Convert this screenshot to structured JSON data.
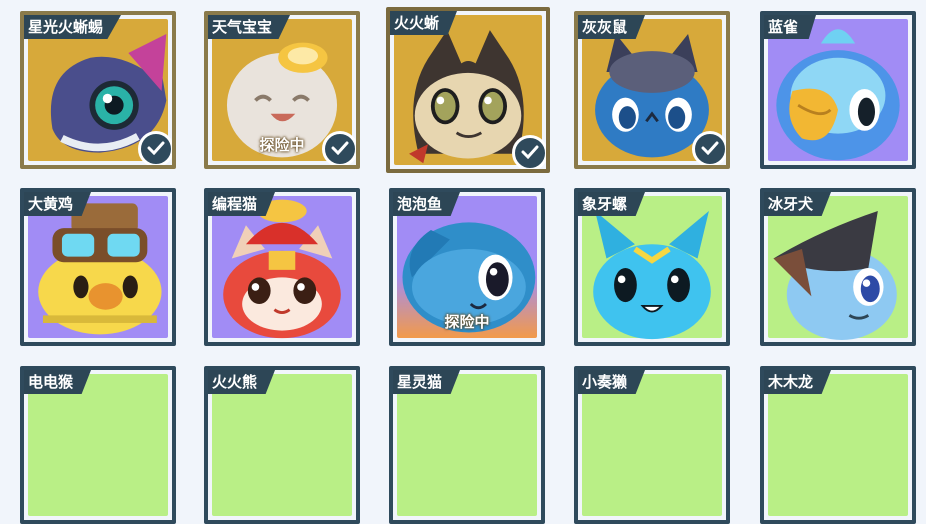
{
  "colors": {
    "gold": "#d7a93a",
    "purple": "#a18cf5",
    "green": "#b9ef86",
    "frame": "#2f4a5c"
  },
  "pets": [
    {
      "name": "星光火蜥蜴",
      "status": "",
      "owned": true
    },
    {
      "name": "天气宝宝",
      "status": "探险中",
      "owned": true
    },
    {
      "name": "火火蜥",
      "status": "",
      "owned": true
    },
    {
      "name": "灰灰鼠",
      "status": "",
      "owned": true
    },
    {
      "name": "蓝雀",
      "status": "",
      "owned": false
    },
    {
      "name": "大黄鸡",
      "status": "",
      "owned": false
    },
    {
      "name": "编程猫",
      "status": "",
      "owned": false
    },
    {
      "name": "泡泡鱼",
      "status": "探险中",
      "owned": false
    },
    {
      "name": "象牙螺",
      "status": "",
      "owned": false
    },
    {
      "name": "冰牙犬",
      "status": "",
      "owned": false
    },
    {
      "name": "电电猴",
      "status": "",
      "owned": false
    },
    {
      "name": "火火熊",
      "status": "",
      "owned": false
    },
    {
      "name": "星灵猫",
      "status": "",
      "owned": false
    },
    {
      "name": "小奏獭",
      "status": "",
      "owned": false
    },
    {
      "name": "木木龙",
      "status": "",
      "owned": false
    }
  ]
}
